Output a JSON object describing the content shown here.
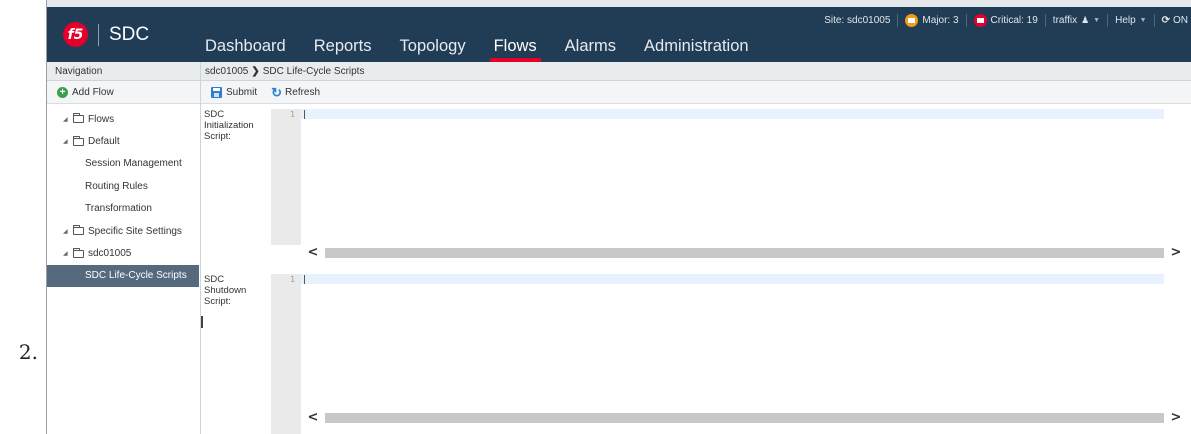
{
  "list_marker": "2.",
  "app": {
    "brand": {
      "badge": "f5",
      "name": "SDC"
    },
    "nav": [
      {
        "label": "Dashboard"
      },
      {
        "label": "Reports"
      },
      {
        "label": "Topology"
      },
      {
        "label": "Flows",
        "active": true
      },
      {
        "label": "Alarms"
      },
      {
        "label": "Administration"
      }
    ],
    "status": {
      "site": "Site: sdc01005",
      "major": "Major: 3",
      "critical": "Critical: 19",
      "user": "traffix",
      "help": "Help",
      "sync": "ON"
    },
    "colors": {
      "header": "#213c55",
      "accent": "#e4002b",
      "major": "#f29b1d",
      "selected": "#566a7e"
    }
  },
  "sidebar": {
    "title": "Navigation",
    "add_flow": "Add Flow",
    "items": [
      {
        "label": "Flows",
        "type": "folder"
      },
      {
        "label": "Default",
        "type": "folder"
      },
      {
        "label": "Session Management",
        "type": "leaf"
      },
      {
        "label": "Routing Rules",
        "type": "leaf"
      },
      {
        "label": "Transformation",
        "type": "leaf"
      },
      {
        "label": "Specific Site Settings",
        "type": "folder"
      },
      {
        "label": "sdc01005",
        "type": "folder"
      },
      {
        "label": "SDC Life-Cycle Scripts",
        "type": "leaf",
        "selected": true
      }
    ]
  },
  "main": {
    "breadcrumb": {
      "site": "sdc01005",
      "page": "SDC Life-Cycle Scripts"
    },
    "toolbar": {
      "submit": "Submit",
      "refresh": "Refresh"
    },
    "scripts": [
      {
        "label": "SDC Initialization Script:",
        "line_number": "1",
        "content": ""
      },
      {
        "label": "SDC Shutdown Script:",
        "line_number": "1",
        "content": ""
      }
    ]
  }
}
